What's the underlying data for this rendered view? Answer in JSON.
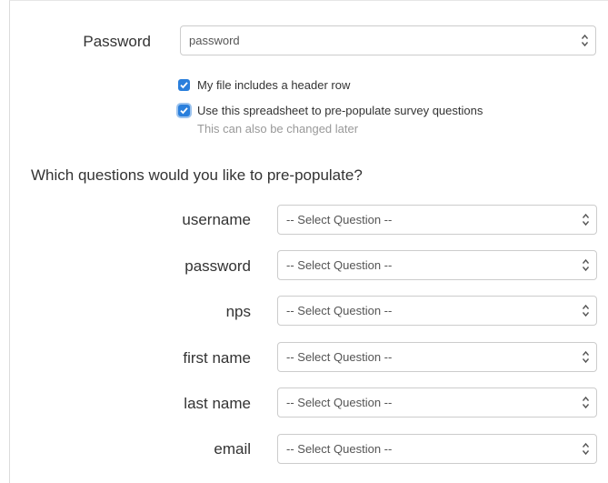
{
  "password_field": {
    "label": "Password",
    "selected": "password"
  },
  "options": {
    "header_row_label": "My file includes a header row",
    "header_row_checked": true,
    "prepopulate_label": "Use this spreadsheet to pre-populate survey questions",
    "prepopulate_checked": true,
    "prepopulate_hint": "This can also be changed later"
  },
  "mapping": {
    "heading": "Which questions would you like to pre-populate?",
    "rows": [
      {
        "label": "username",
        "selected": "-- Select Question --"
      },
      {
        "label": "password",
        "selected": "-- Select Question --"
      },
      {
        "label": "nps",
        "selected": "-- Select Question --"
      },
      {
        "label": "first name",
        "selected": "-- Select Question --"
      },
      {
        "label": "last name",
        "selected": "-- Select Question --"
      },
      {
        "label": "email",
        "selected": "-- Select Question --"
      }
    ]
  },
  "colors": {
    "checkbox": "#2a7fdc",
    "border": "#cccccc",
    "hint": "#999999"
  },
  "icons": {
    "select_arrows": "up-down-chevron-icon",
    "checkbox_check": "checkmark-icon"
  }
}
